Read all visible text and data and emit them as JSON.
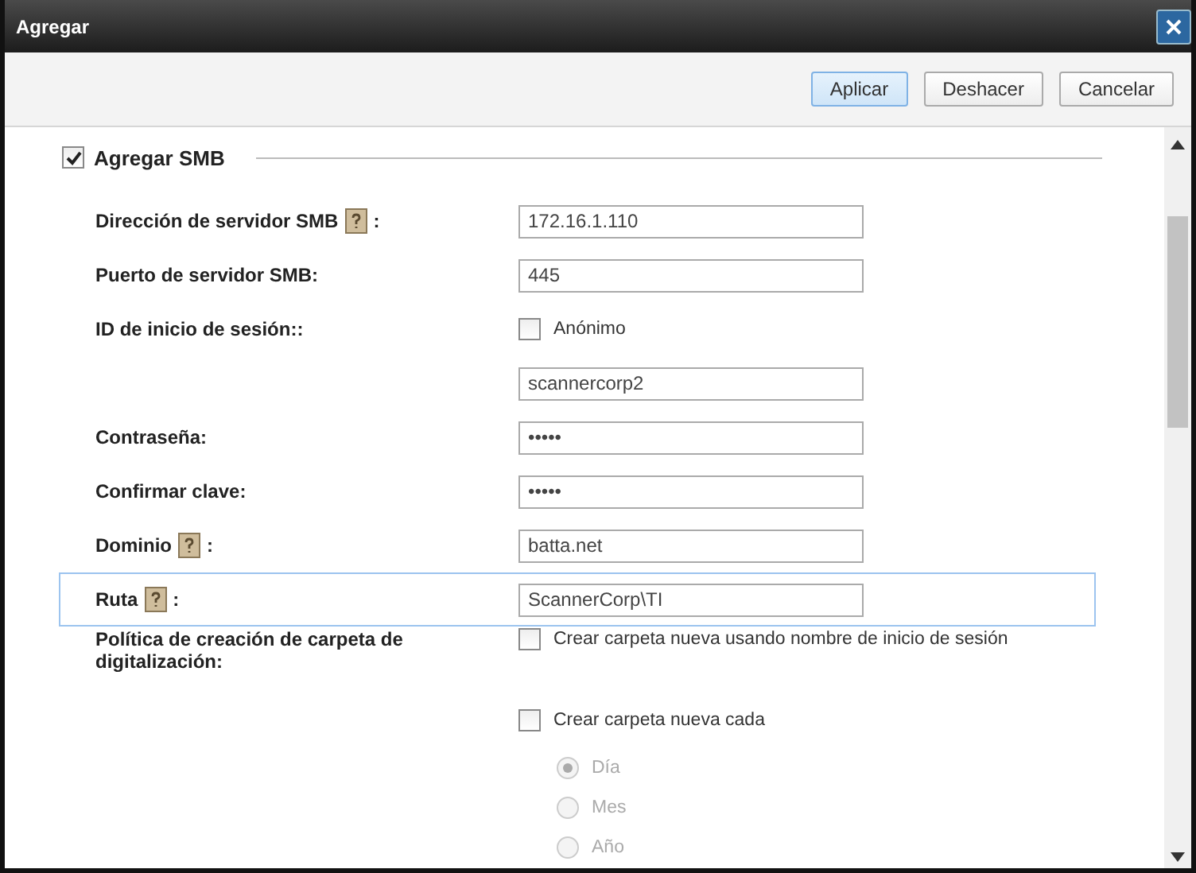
{
  "window": {
    "title": "Agregar"
  },
  "toolbar": {
    "buttons": [
      {
        "label": "Aplicar",
        "primary": true
      },
      {
        "label": "Deshacer",
        "primary": false
      },
      {
        "label": "Cancelar",
        "primary": false
      }
    ]
  },
  "section": {
    "label": "Agregar SMB",
    "checked": true
  },
  "rows": [
    {
      "kind": "text",
      "label": "Dirección de servidor SMB",
      "help": true,
      "suffix": ":",
      "value": "172.16.1.110",
      "focused": false
    },
    {
      "kind": "text",
      "label": "Puerto de servidor SMB:",
      "help": false,
      "value": "445",
      "focused": false
    },
    {
      "kind": "checkbox",
      "label": "ID de inicio de sesión::",
      "option": "Anónimo",
      "checked": false
    },
    {
      "kind": "text",
      "value": "scannercorp2",
      "focused": false
    },
    {
      "kind": "text",
      "label": "Contraseña:",
      "help": false,
      "value": "•••••",
      "focused": false
    },
    {
      "kind": "text",
      "label": "Confirmar clave:",
      "help": false,
      "value": "•••••",
      "focused": false
    },
    {
      "kind": "text",
      "label": "Dominio",
      "help": true,
      "suffix": ":",
      "value": "batta.net",
      "focused": false
    },
    {
      "kind": "text",
      "label": "Ruta",
      "help": true,
      "suffix": ":",
      "value": "ScannerCorp\\TI",
      "focused": true
    },
    {
      "kind": "checkbox",
      "label": "Política de creación de carpeta de digitalización:",
      "option": "Crear carpeta nueva usando nombre de inicio de sesión",
      "checked": false
    },
    {
      "kind": "checkbox",
      "option": "Crear carpeta nueva cada",
      "checked": false
    },
    {
      "kind": "radio",
      "option": "Día",
      "selected": true,
      "disabled": true
    },
    {
      "kind": "radio",
      "option": "Mes",
      "selected": false,
      "disabled": true
    },
    {
      "kind": "radio",
      "option": "Año",
      "selected": false,
      "disabled": true
    }
  ]
}
